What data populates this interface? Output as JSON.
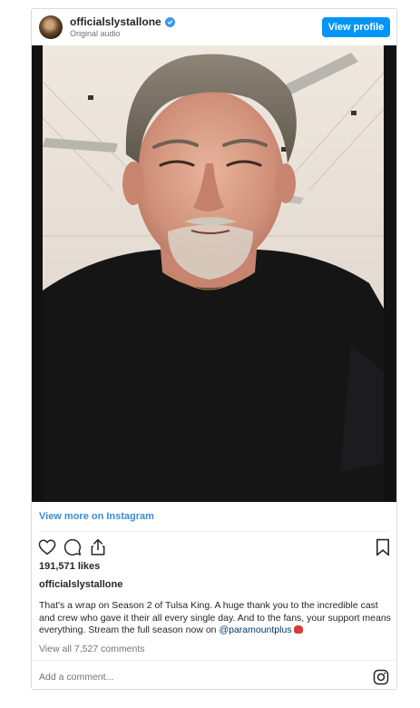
{
  "header": {
    "username": "officialslystallone",
    "audio": "Original audio",
    "view_profile": "View profile"
  },
  "media": {
    "alt": "Video frame of a man in a black t-shirt smiling at the camera indoors"
  },
  "post": {
    "view_more": "View more on Instagram",
    "likes": "191,571 likes",
    "caption_username": "officialslystallone",
    "caption_text": "That's a wrap on Season 2 of Tulsa King. A huge thank you to the incredible cast and crew who gave it their all every single day. And to the fans, your support means everything. Stream the full season now on ",
    "caption_mention": "@paramountplus",
    "view_comments": "View all 7,527 comments",
    "add_comment": "Add a comment..."
  },
  "icons": {
    "like": "heart-icon",
    "comment": "comment-icon",
    "share": "share-icon",
    "save": "bookmark-icon",
    "instagram": "instagram-icon",
    "verified": "verified-badge-icon",
    "emoji": "boxing-glove-icon"
  },
  "colors": {
    "accent": "#0095f6",
    "link": "#3c8cd3",
    "mention": "#00376b",
    "muted": "#737373"
  }
}
